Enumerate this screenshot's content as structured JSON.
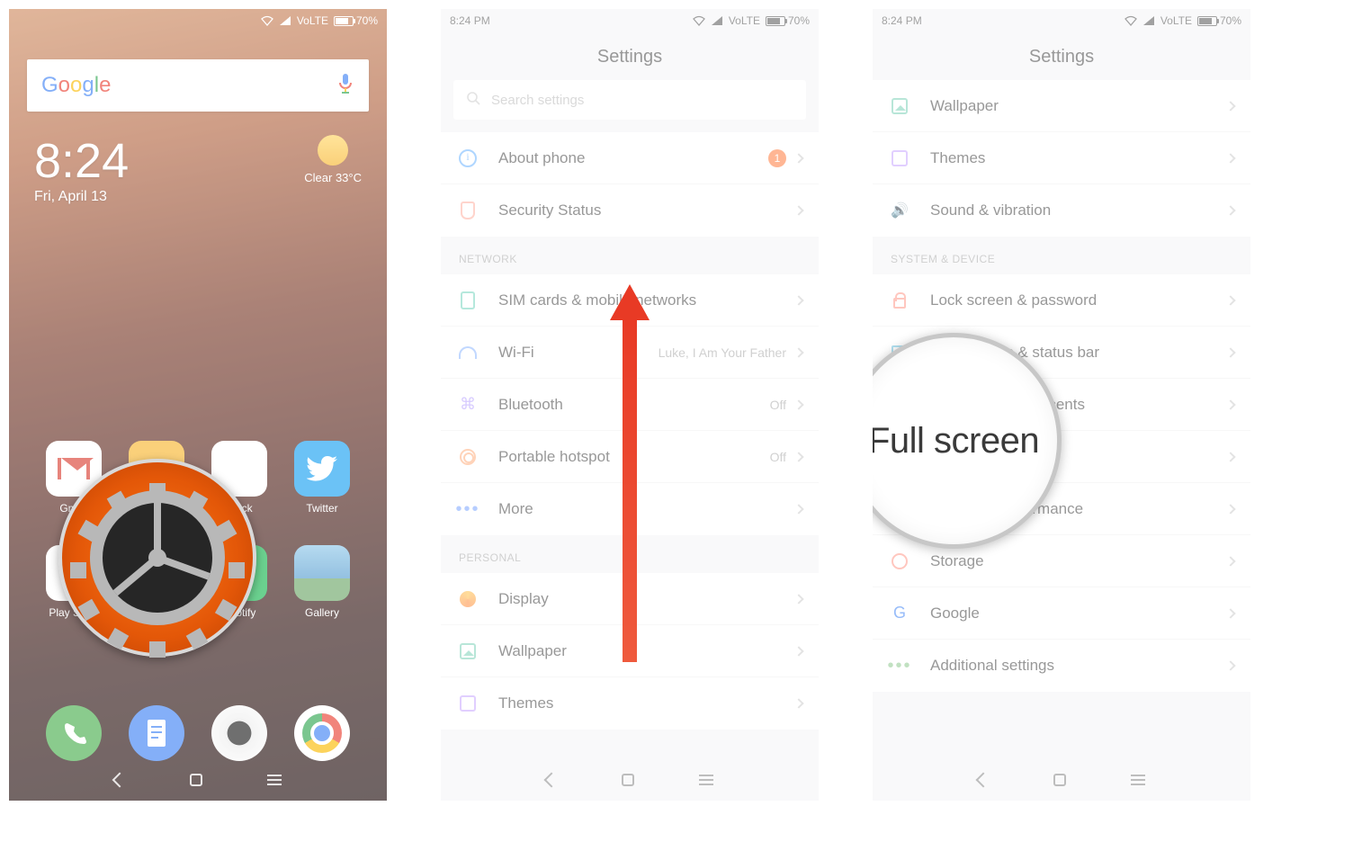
{
  "statusbar": {
    "time": "8:24 PM",
    "volte": "VoLTE",
    "batt_pct": "70%"
  },
  "home": {
    "google_label": "Google",
    "clock_time": "8:24",
    "clock_date": "Fri, April 13",
    "weather_cond": "Clear",
    "weather_temp": "33°C",
    "apps": {
      "gmail": "Gmail",
      "slack": "Slack",
      "twitter": "Twitter",
      "play": "Play Store",
      "spotify": "Spotify",
      "gallery": "Gallery"
    }
  },
  "settings": {
    "title": "Settings",
    "search_placeholder": "Search settings",
    "groups": {
      "network": "NETWORK",
      "personal": "PERSONAL",
      "system": "SYSTEM & DEVICE"
    },
    "items": {
      "about": "About phone",
      "about_badge": "1",
      "security": "Security Status",
      "sim": "SIM cards & mobile networks",
      "wifi": "Wi-Fi",
      "wifi_value": "Luke, I Am Your Father",
      "bt": "Bluetooth",
      "bt_value": "Off",
      "hotspot": "Portable hotspot",
      "hotspot_value": "Off",
      "more": "More",
      "display": "Display",
      "wallpaper": "Wallpaper",
      "themes": "Themes",
      "sound": "Sound & vibration",
      "lock": "Lock screen & password",
      "notif": "Notifications & status bar",
      "split": "Split screen & Recents",
      "full": "Full screen",
      "battery": "Battery & performance",
      "storage": "Storage",
      "google": "Google",
      "additional": "Additional settings"
    }
  },
  "magnifier_text": "Full screen"
}
